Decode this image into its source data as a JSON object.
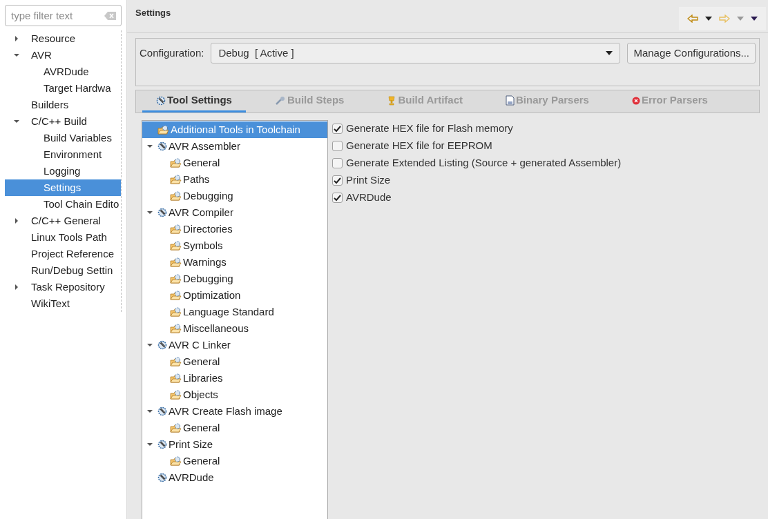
{
  "filter": {
    "placeholder": "type filter text"
  },
  "nav": [
    {
      "label": "Resource",
      "expanded": false,
      "selected": false
    },
    {
      "label": "AVR",
      "expanded": true,
      "selected": false,
      "children": [
        {
          "label": "AVRDude",
          "selected": false
        },
        {
          "label": "Target Hardwa",
          "selected": false
        }
      ]
    },
    {
      "label": "Builders",
      "selected": false
    },
    {
      "label": "C/C++ Build",
      "expanded": true,
      "selected": false,
      "children": [
        {
          "label": "Build Variables",
          "selected": false
        },
        {
          "label": "Environment",
          "selected": false
        },
        {
          "label": "Logging",
          "selected": false
        },
        {
          "label": "Settings",
          "selected": true
        },
        {
          "label": "Tool Chain Edito",
          "selected": false
        }
      ]
    },
    {
      "label": "C/C++ General",
      "expanded": false,
      "selected": false
    },
    {
      "label": "Linux Tools Path",
      "selected": false
    },
    {
      "label": "Project Reference",
      "selected": false
    },
    {
      "label": "Run/Debug Settin",
      "selected": false
    },
    {
      "label": "Task Repository",
      "expanded": false,
      "selected": false
    },
    {
      "label": "WikiText",
      "selected": false
    }
  ],
  "page_title": "Settings",
  "configuration": {
    "label": "Configuration:",
    "value": "Debug  [ Active ]",
    "button": "Manage Configurations..."
  },
  "tabs": [
    {
      "label": "Tool Settings",
      "kind": "tool",
      "selected": true
    },
    {
      "label": "Build Steps",
      "kind": "steps",
      "selected": false
    },
    {
      "label": "Build Artifact",
      "kind": "artifact",
      "selected": false
    },
    {
      "label": "Binary Parsers",
      "kind": "binary",
      "selected": false
    },
    {
      "label": "Error Parsers",
      "kind": "error",
      "selected": false
    }
  ],
  "tool_tree": [
    {
      "label": "Additional Tools in Toolchain",
      "kind": "category",
      "selected": true
    },
    {
      "label": "AVR Assembler",
      "kind": "tool",
      "expanded": true,
      "selected": false,
      "children": [
        {
          "label": "General",
          "kind": "category",
          "selected": false
        },
        {
          "label": "Paths",
          "kind": "category",
          "selected": false
        },
        {
          "label": "Debugging",
          "kind": "category",
          "selected": false
        }
      ]
    },
    {
      "label": "AVR Compiler",
      "kind": "tool",
      "expanded": true,
      "selected": false,
      "children": [
        {
          "label": "Directories",
          "kind": "category",
          "selected": false
        },
        {
          "label": "Symbols",
          "kind": "category",
          "selected": false
        },
        {
          "label": "Warnings",
          "kind": "category",
          "selected": false
        },
        {
          "label": "Debugging",
          "kind": "category",
          "selected": false
        },
        {
          "label": "Optimization",
          "kind": "category",
          "selected": false
        },
        {
          "label": "Language Standard",
          "kind": "category",
          "selected": false
        },
        {
          "label": "Miscellaneous",
          "kind": "category",
          "selected": false
        }
      ]
    },
    {
      "label": "AVR C Linker",
      "kind": "tool",
      "expanded": true,
      "selected": false,
      "children": [
        {
          "label": "General",
          "kind": "category",
          "selected": false
        },
        {
          "label": "Libraries",
          "kind": "category",
          "selected": false
        },
        {
          "label": "Objects",
          "kind": "category",
          "selected": false
        }
      ]
    },
    {
      "label": "AVR Create Flash image",
      "kind": "tool",
      "expanded": true,
      "selected": false,
      "children": [
        {
          "label": "General",
          "kind": "category",
          "selected": false
        }
      ]
    },
    {
      "label": "Print Size",
      "kind": "tool",
      "expanded": true,
      "selected": false,
      "children": [
        {
          "label": "General",
          "kind": "category",
          "selected": false
        }
      ]
    },
    {
      "label": "AVRDude",
      "kind": "tool",
      "selected": false
    }
  ],
  "options": [
    {
      "label": "Generate HEX file for Flash memory",
      "checked": true
    },
    {
      "label": "Generate HEX file for EEPROM",
      "checked": false
    },
    {
      "label": "Generate Extended Listing (Source + generated Assembler)",
      "checked": false
    },
    {
      "label": "Print Size",
      "checked": true
    },
    {
      "label": "AVRDude",
      "checked": true
    }
  ]
}
